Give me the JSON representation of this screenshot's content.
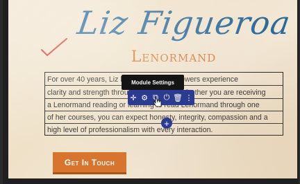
{
  "brand": {
    "name": "Liz Figueroa",
    "subtitle": "Lenormand"
  },
  "text_module": {
    "lines": [
      "For over 40 years, Liz has helped her followers experience",
      "clarity and strength through Lenormand. Whether you are receiving",
      "a Lenormand reading or learning to read Lenormand through one",
      "of her courses, you can expect honesty, integrity, compassion and a",
      "high level of professionalism with every interaction."
    ]
  },
  "module_toolbar": {
    "tooltip": "Module Settings",
    "buttons": [
      "move-icon",
      "gear-icon",
      "duplicate-icon",
      "power-icon",
      "trash-icon",
      "more-icon"
    ]
  },
  "cta": {
    "label": "Get In Touch"
  },
  "colors": {
    "brand_blue": "#2c6a9a",
    "accent_orange": "#d67a38",
    "toolbar_blue": "#2b3b8f",
    "check_red": "#e0443a"
  }
}
